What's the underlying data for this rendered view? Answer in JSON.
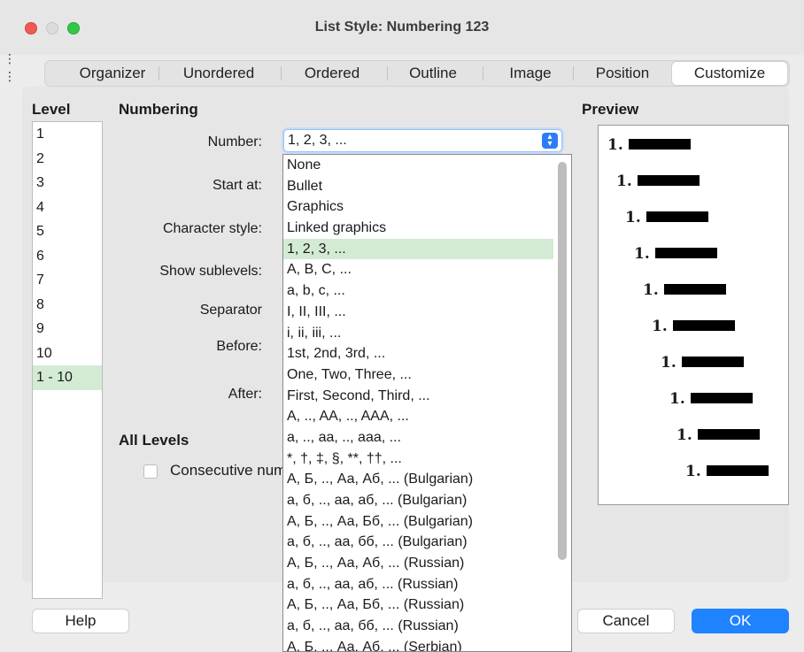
{
  "window": {
    "title": "List Style: Numbering 123"
  },
  "tabs": [
    {
      "label": "Organizer"
    },
    {
      "label": "Unordered"
    },
    {
      "label": "Ordered"
    },
    {
      "label": "Outline"
    },
    {
      "label": "Image"
    },
    {
      "label": "Position"
    },
    {
      "label": "Customize",
      "active": true
    }
  ],
  "level": {
    "heading": "Level",
    "items": [
      "1",
      "2",
      "3",
      "4",
      "5",
      "6",
      "7",
      "8",
      "9",
      "10",
      "1 - 10"
    ],
    "selected": "1 - 10"
  },
  "numbering": {
    "heading": "Numbering",
    "labels": {
      "number": "Number:",
      "start_at": "Start at:",
      "character_style": "Character style:",
      "show_sublevels": "Show sublevels:",
      "separator": "Separator",
      "before": "Before:",
      "after": "After:"
    },
    "number_value": "1, 2, 3, ..."
  },
  "dropdown": {
    "options": [
      "None",
      "Bullet",
      "Graphics",
      "Linked graphics",
      "1, 2, 3, ...",
      "A, B, C, ...",
      "a, b, c, ...",
      "I, II, III, ...",
      "i, ii, iii, ...",
      "1st, 2nd, 3rd, ...",
      "One, Two, Three, ...",
      "First, Second, Third, ...",
      "A, .., AA, .., AAA, ...",
      "a, .., aa, .., aaa, ...",
      "*, †, ‡, §, **, ††, ...",
      "А, Б, .., Аа, Аб, ... (Bulgarian)",
      "а, б, .., аа, аб, ... (Bulgarian)",
      "А, Б, .., Аа, Бб, ... (Bulgarian)",
      "а, б, .., аа, бб, ... (Bulgarian)",
      "А, Б, .., Аа, Аб, ... (Russian)",
      "а, б, .., аа, аб, ... (Russian)",
      "А, Б, .., Аа, Бб, ... (Russian)",
      "а, б, .., аа, бб, ... (Russian)",
      "А, Б, .., Аа, Аб, ... (Serbian)"
    ],
    "selected": "1, 2, 3, ..."
  },
  "all_levels": {
    "heading": "All Levels",
    "consecutive_label": "Consecutive numbering"
  },
  "preview": {
    "heading": "Preview",
    "rows": [
      "1.",
      "1.",
      "1.",
      "1.",
      "1.",
      "1.",
      "1.",
      "1.",
      "1.",
      "1."
    ]
  },
  "buttons": {
    "help": "Help",
    "cancel": "Cancel",
    "ok": "OK"
  }
}
